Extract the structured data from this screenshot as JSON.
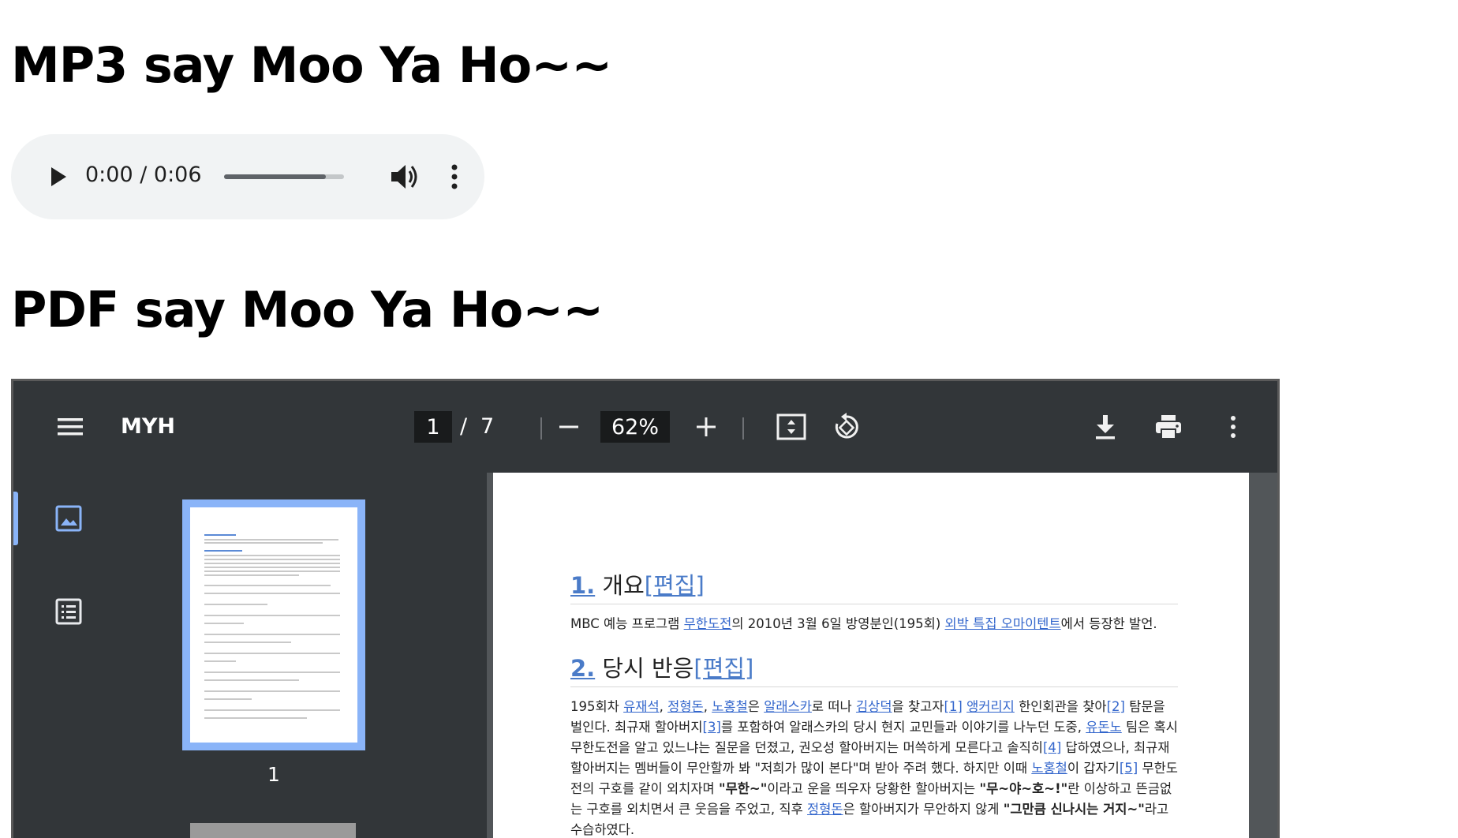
{
  "headings": {
    "mp3": "MP3 say Moo Ya Ho~~",
    "pdf": "PDF say Moo Ya Ho~~"
  },
  "audio": {
    "time_display": "0:00 / 0:06",
    "progress_fraction": 0.85,
    "icons": [
      "play-icon",
      "volume-icon",
      "more-vert-icon"
    ]
  },
  "pdf_viewer": {
    "title": "MYH",
    "current_page": "1",
    "page_separator": "/",
    "total_pages": "7",
    "zoom": "62%",
    "thumbnail_label": "1",
    "colors": {
      "toolbar": "#323639",
      "background": "#525659",
      "accent": "#8ab4f8",
      "link": "#3366cc"
    }
  },
  "document": {
    "sections": [
      {
        "number": "1.",
        "title": " 개요",
        "edit": "[편집]",
        "body": [
          {
            "t": "MBC 예능 프로그램 "
          },
          {
            "t": "무한도전",
            "link": true
          },
          {
            "t": "의 2010년 3월 6일 방영분인(195회) "
          },
          {
            "t": "외박 특집 오마이텐트",
            "link": true
          },
          {
            "t": "에서 등장한 발언."
          }
        ]
      },
      {
        "number": "2.",
        "title": " 당시 반응",
        "edit": "[편집]",
        "body": [
          {
            "t": "195회차 "
          },
          {
            "t": "유재석",
            "link": true
          },
          {
            "t": ", "
          },
          {
            "t": "정형돈",
            "link": true
          },
          {
            "t": ", "
          },
          {
            "t": "노홍철",
            "link": true
          },
          {
            "t": "은 "
          },
          {
            "t": "알래스카",
            "link": true
          },
          {
            "t": "로 떠나 "
          },
          {
            "t": "김상덕",
            "link": true
          },
          {
            "t": "을 찾고자"
          },
          {
            "t": "[1]",
            "link": true
          },
          {
            "t": " "
          },
          {
            "t": "앵커리지",
            "link": true
          },
          {
            "t": " 한인회관을 찾아"
          },
          {
            "t": "[2]",
            "link": true
          },
          {
            "t": " 탐문을 벌인다. 최규재 할아버지"
          },
          {
            "t": "[3]",
            "link": true
          },
          {
            "t": "를 포함하여 알래스카의 당시 현지 교민들과 이야기를 나누던 도중, "
          },
          {
            "t": "유돈노",
            "link": true
          },
          {
            "t": " 팀은 혹시 무한도전을 알고 있느냐는 질문을 던졌고, 권오성 할아버지는 머쓱하게 모른다고 솔직히"
          },
          {
            "t": "[4]",
            "link": true
          },
          {
            "t": " 답하였으나, 최규재 할아버지는 멤버들이 무안할까 봐 \"저희가 많이 본다\"며 받아 주려 했다. 하지만 이때 "
          },
          {
            "t": "노홍철",
            "link": true
          },
          {
            "t": "이 갑자기"
          },
          {
            "t": "[5]",
            "link": true
          },
          {
            "t": " 무한도전의 구호를 같이 외치자며 "
          },
          {
            "t": "\"무한~\"",
            "bold": true
          },
          {
            "t": "이라고 운을 띄우자 당황한 할아버지는 "
          },
          {
            "t": "\"무~야~호~!\"",
            "bold": true
          },
          {
            "t": "란 이상하고 뜬금없는 구호를 외치면서 큰 웃음을 주었고, 직후 "
          },
          {
            "t": "정형돈",
            "link": true
          },
          {
            "t": "은 할아버지가 무안하지 않게 "
          },
          {
            "t": "\"그만큼 신나시는 거지~\"",
            "bold": true
          },
          {
            "t": "라고 수습하였다."
          }
        ]
      }
    ]
  }
}
